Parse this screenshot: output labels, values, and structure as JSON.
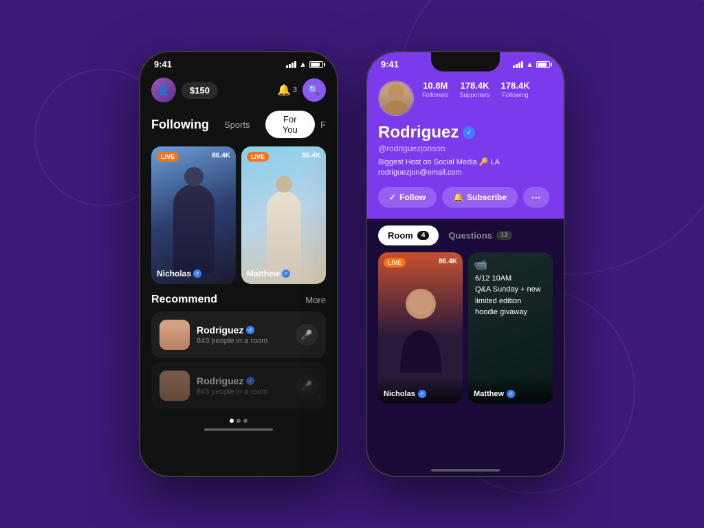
{
  "background": "#3d1a7a",
  "phone1": {
    "status": {
      "time": "9:41",
      "notifications": "3"
    },
    "header": {
      "balance": "$150",
      "notif_icon": "bell",
      "notif_count": "3",
      "search_icon": "search"
    },
    "tabs": {
      "title": "Following",
      "tab_sports": "Sports",
      "tab_for_you": "For You",
      "tab_active": "For You"
    },
    "live_cards": [
      {
        "badge": "LIVE",
        "count": "86.4K",
        "name": "Nicholas",
        "verified": true
      },
      {
        "badge": "LIVE",
        "count": "86.4K",
        "name": "Matthew",
        "verified": true
      }
    ],
    "recommend": {
      "title": "Recommend",
      "more": "More",
      "items": [
        {
          "name": "Rodriguez",
          "verified": true,
          "sub": "843 people in a room"
        },
        {
          "name": "Rodriguez",
          "verified": true,
          "sub": "843 people in a room"
        }
      ]
    }
  },
  "phone2": {
    "status": {
      "time": "9:41"
    },
    "profile": {
      "name": "Rodriguez",
      "handle": "@rodriguezjonson",
      "verified": true,
      "bio_line1": "Biggest Host on Social Media 🔑 LA",
      "bio_line2": "rodriguezjon@email.com",
      "stats": {
        "followers": {
          "value": "10.8M",
          "label": "Followers"
        },
        "supporters": {
          "value": "178.4K",
          "label": "Supporters"
        },
        "following": {
          "value": "178.4K",
          "label": "Following"
        }
      },
      "actions": {
        "follow": "Follow",
        "subscribe": "Subscribe",
        "more": "···"
      }
    },
    "tabs": {
      "room": "Room",
      "room_count": "4",
      "questions": "Questions",
      "questions_count": "12"
    },
    "cards": [
      {
        "badge": "LIVE",
        "count": "86.4K",
        "name": "Nicholas",
        "verified": true
      },
      {
        "date": "6/12 10AM",
        "event": "Q&A Sunday + new limited edition hoodie givaway",
        "name": "Matthew",
        "verified": true
      }
    ]
  }
}
